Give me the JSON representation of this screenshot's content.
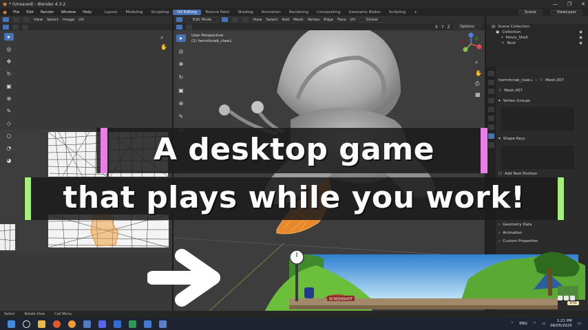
{
  "window": {
    "title": "* (Unsaved) - Blender 4.3.2",
    "controls": [
      "—",
      "❐",
      "✕"
    ]
  },
  "menu": {
    "items": [
      "File",
      "Edit",
      "Render",
      "Window",
      "Help"
    ],
    "workspaces": [
      "Layout",
      "Modeling",
      "Sculpting",
      "UV Editing",
      "Texture Paint",
      "Shading",
      "Animation",
      "Rendering",
      "Compositing",
      "Geometry Nodes",
      "Scripting",
      "+"
    ],
    "active_workspace": "UV Editing",
    "scene_label": "Scene",
    "view_layer_label": "ViewLayer"
  },
  "uv_editor": {
    "header": [
      "View",
      "Select",
      "Image",
      "UV"
    ]
  },
  "viewport": {
    "mode": "Edit Mode",
    "header": [
      "View",
      "Select",
      "Add",
      "Mesh",
      "Vertex",
      "Edge",
      "Face",
      "UV"
    ],
    "orientation": "Global",
    "options_label": "Options",
    "axis_labels": [
      "X",
      "Y",
      "Z"
    ],
    "info_line1": "User Perspective",
    "info_line2": "(1) hermitcrab_claw.L"
  },
  "outliner": {
    "rows": [
      "Scene Collection",
      "Collection",
      "Pelvis_Shell",
      "Root"
    ]
  },
  "properties": {
    "object_name": "hermitcrab_claw.L",
    "mesh_name": "Mesh.007",
    "mesh_field": "Mesh.007",
    "sections": [
      "Vertex Groups",
      "Shape Keys",
      "Add Rest Position",
      "Geometry Data",
      "Animation",
      "Custom Properties"
    ]
  },
  "status_bar": {
    "items": [
      "Select",
      "Rotate View",
      "Call Menu"
    ]
  },
  "taskbar": {
    "tray_lang": "ENG",
    "time": "1:21 PM",
    "date": "06/05/2025"
  },
  "game": {
    "sign_text": "SCREENSHOT",
    "counter": "370"
  },
  "overlay": {
    "line1": "A desktop game",
    "line2": "that plays while you work!",
    "colors": {
      "pink": "#e97ce6",
      "green": "#a6f07a",
      "banner": "#1c1c1c"
    }
  }
}
